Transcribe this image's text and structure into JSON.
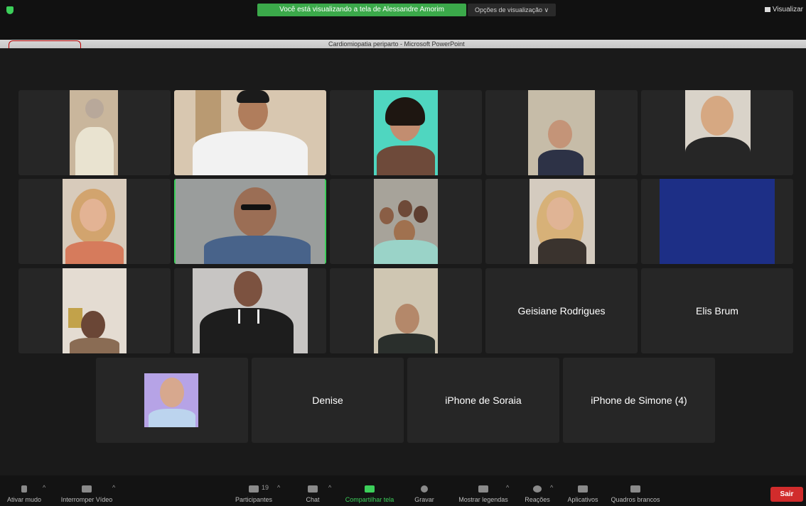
{
  "banner": {
    "text": "Você está visualizando a tela de Alessandre Amorim",
    "view_options": "Opções de visualização ∨",
    "visualizar": "Visualizar"
  },
  "shared_window": {
    "title": "Cardiomiopatia periparto - Microsoft PowerPoint"
  },
  "participants_named": {
    "geisiane": "Geisiane Rodrigues",
    "elis": "Elis Brum",
    "denise": "Denise",
    "soraia": "iPhone de Soraia",
    "simone": "iPhone de Simone (4)"
  },
  "toolbar": {
    "mute": "Ativar mudo",
    "video": "Interromper Vídeo",
    "participants": "Participantes",
    "participants_count": "19",
    "chat": "Chat",
    "share": "Compartilhar tela",
    "record": "Gravar",
    "captions": "Mostrar legendas",
    "reactions": "Reações",
    "apps": "Aplicativos",
    "whiteboards": "Quadros brancos",
    "exit": "Sair"
  },
  "colors": {
    "banner_green": "#3ba94a",
    "active_speaker": "#3ccf5a",
    "exit_red": "#d12c2c",
    "tile_bg": "#262626"
  }
}
